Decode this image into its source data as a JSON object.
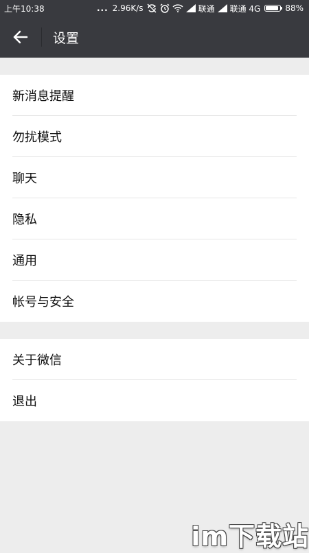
{
  "status_bar": {
    "time": "上午10:38",
    "dots": "...",
    "speed": "2.96K/s",
    "carrier1": "联通",
    "carrier2": "联通 4G",
    "battery_percent": "88%",
    "battery_level": 0.88,
    "icons": [
      "data-sync-icon",
      "alarm-icon",
      "wifi-icon",
      "signal-icon",
      "signal-icon",
      "battery-icon"
    ]
  },
  "header": {
    "title": "设置",
    "back_icon": "back-arrow-icon"
  },
  "groups": [
    {
      "items": [
        {
          "label": "新消息提醒"
        },
        {
          "label": "勿扰模式"
        },
        {
          "label": "聊天"
        },
        {
          "label": "隐私"
        },
        {
          "label": "通用"
        },
        {
          "label": "帐号与安全"
        }
      ]
    },
    {
      "items": [
        {
          "label": "关于微信"
        },
        {
          "label": "退出"
        }
      ]
    }
  ],
  "watermark": "im下载站",
  "colors": {
    "header_bg": "#393a3f",
    "page_bg": "#ededed",
    "item_bg": "#ffffff",
    "divider": "#e5e5e5"
  }
}
